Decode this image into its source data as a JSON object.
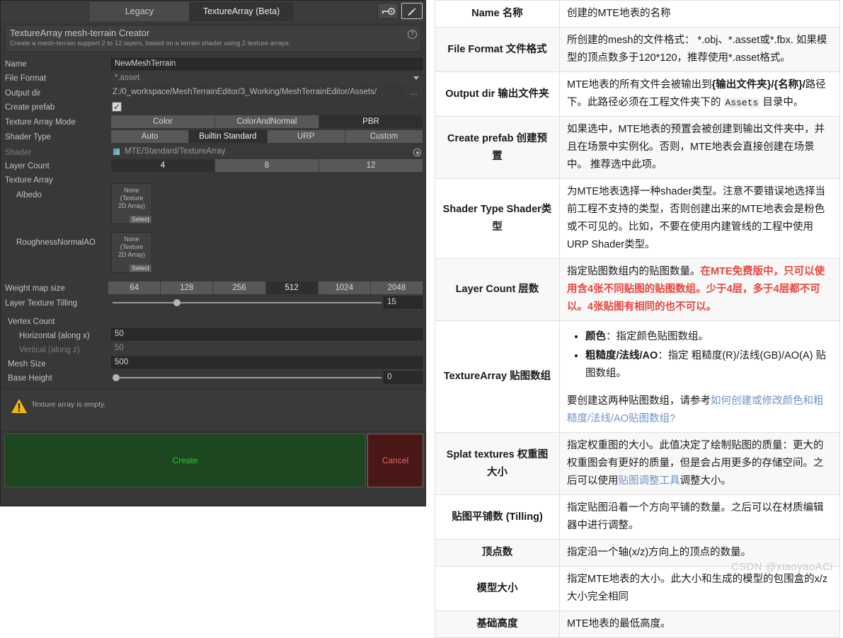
{
  "editor": {
    "tabs": [
      {
        "label": "Legacy",
        "active": false
      },
      {
        "label": "TextureArray (Beta)",
        "active": true
      }
    ],
    "icons": {
      "key": "key-icon",
      "edit": "edit-pencil-icon",
      "help": "?"
    },
    "header": {
      "title": "TextureArray mesh-terrain Creator",
      "subtitle": "Create a mesh-terrain support 2 to 12 layers, based on a terrain shader using 2 texture arrays."
    },
    "fields": {
      "name": {
        "label": "Name",
        "value": "NewMeshTerrain"
      },
      "file_format": {
        "label": "File Format",
        "value": "*.asset"
      },
      "output_dir": {
        "label": "Output dir",
        "value": "Z:/0_workspace/MeshTerrainEditor/3_Working/MeshTerrainEditor/Assets/",
        "browse": "..."
      },
      "create_prefab": {
        "label": "Create prefab",
        "checked": true,
        "mark": "✓"
      },
      "texture_array_mode": {
        "label": "Texture Array Mode",
        "options": [
          "Color",
          "ColorAndNormal",
          "PBR"
        ],
        "selected": "PBR"
      },
      "shader_type": {
        "label": "Shader Type",
        "options": [
          "Auto",
          "Builtin Standard",
          "URP",
          "Custom"
        ],
        "selected": "Builtin Standard"
      },
      "shader": {
        "label": "Shader",
        "value": "MTE/Standard/TextureArray"
      },
      "layer_count": {
        "label": "Layer Count",
        "options": [
          "4",
          "8",
          "12"
        ],
        "selected": "4"
      },
      "texture_array": {
        "label": "Texture Array"
      },
      "albedo": {
        "label": "Albedo",
        "value": "None\n(Texture\n2D Array)",
        "select": "Select"
      },
      "roughness": {
        "label": "RoughnessNormalAO",
        "value": "None\n(Texture\n2D Array)",
        "select": "Select"
      },
      "weight_map_size": {
        "label": "Weight map size",
        "options": [
          "64",
          "128",
          "256",
          "512",
          "1024",
          "2048"
        ],
        "selected": "512"
      },
      "layer_texture_tilling": {
        "label": "Layer Texture Tilling",
        "value": "15",
        "knob_pct": 24
      },
      "vertex_count": {
        "label": "Vertex Count"
      },
      "horizontal": {
        "label": "Horizontal (along x)",
        "value": "50"
      },
      "vertical": {
        "label": "Vertical (along z)",
        "value": "50"
      },
      "mesh_size": {
        "label": "Mesh Size",
        "value": "500"
      },
      "base_height": {
        "label": "Base Height",
        "value": "0",
        "knob_pct": 0
      }
    },
    "warning": {
      "icon": "warning-triangle-icon",
      "text": "Texture array is empty."
    },
    "buttons": {
      "create": "Create",
      "cancel": "Cancel"
    }
  },
  "doc": {
    "rows": [
      {
        "key": "Name 名称",
        "alt": false,
        "value_html": "创建的MTE地表的名称"
      },
      {
        "key": "File Format 文件格式",
        "alt": true,
        "value_html": "所创建的mesh的文件格式：  *.obj、*.asset或*.fbx. 如果模型的顶点数多于120*120，推荐使用*.asset格式。"
      },
      {
        "key": "Output dir 输出文件夹",
        "alt": false,
        "value_html": "MTE地表的所有文件会被输出到<span class=\"b\">{输出文件夹}/{名称}/</span>路径下。此路径必须在工程文件夹下的 <span class=\"mono\">Assets</span> 目录中。"
      },
      {
        "key": "Create prefab 创建预置",
        "alt": true,
        "value_html": "如果选中，MTE地表的预置会被创建到输出文件夹中，并且在场景中实例化。否则，MTE地表会直接创建在场景中。 推荐选中此项。"
      },
      {
        "key": "Shader Type Shader类型",
        "alt": false,
        "value_html": "为MTE地表选择一种shader类型。注意不要错误地选择当前工程不支持的类型，否则创建出来的MTE地表会是粉色或不可见的。比如，不要在使用内建管线的工程中使用URP Shader类型。"
      },
      {
        "key": "Layer Count 层数",
        "alt": true,
        "value_html": "指定贴图数组内的贴图数量。<span class=\"redtext\">在MTE免费版中，只可以使用含4张不同贴图的贴图数组。少于4层，多于4层都不可以。4张贴图有相同的也不可以。</span>"
      },
      {
        "key": "TextureArray 贴图数组",
        "alt": false,
        "value_html": "<ul class=\"vlist\"><li><span class=\"b\">颜色</span>：指定颜色贴图数组。</li><li><span class=\"b\">粗糙度/法线/AO</span>：指定 粗糙度(R)/法线(GB)/AO(A) 贴图数组。</li></ul><div style=\"margin-top:14px\">要创建这两种贴图数组，请参考<span class=\"lnk\">如何创建或修改颜色和粗糙度/法线/AO贴图数组?</span></div>"
      },
      {
        "key": "Splat textures 权重图大小",
        "alt": true,
        "value_html": "指定权重图的大小。此值决定了绘制贴图的质量：更大的权重图会有更好的质量，但是会占用更多的存储空间。之后可以使用<span class=\"lnk\">贴图调整工具</span>调整大小。"
      },
      {
        "key": "贴图平铺数 (Tilling)",
        "alt": false,
        "value_html": "指定贴图沿着一个方向平铺的数量。之后可以在材质编辑器中进行调整。"
      },
      {
        "key": "顶点数",
        "alt": true,
        "value_html": "指定沿一个轴(x/z)方向上的顶点的数量。"
      },
      {
        "key": "模型大小",
        "alt": false,
        "value_html": "指定MTE地表的大小。此大小和生成的模型的包围盒的x/z大小完全相同"
      },
      {
        "key": "基础高度",
        "alt": true,
        "value_html": "MTE地表的最低高度。"
      }
    ],
    "watermark": "CSDN @xiaoyaoACi"
  }
}
